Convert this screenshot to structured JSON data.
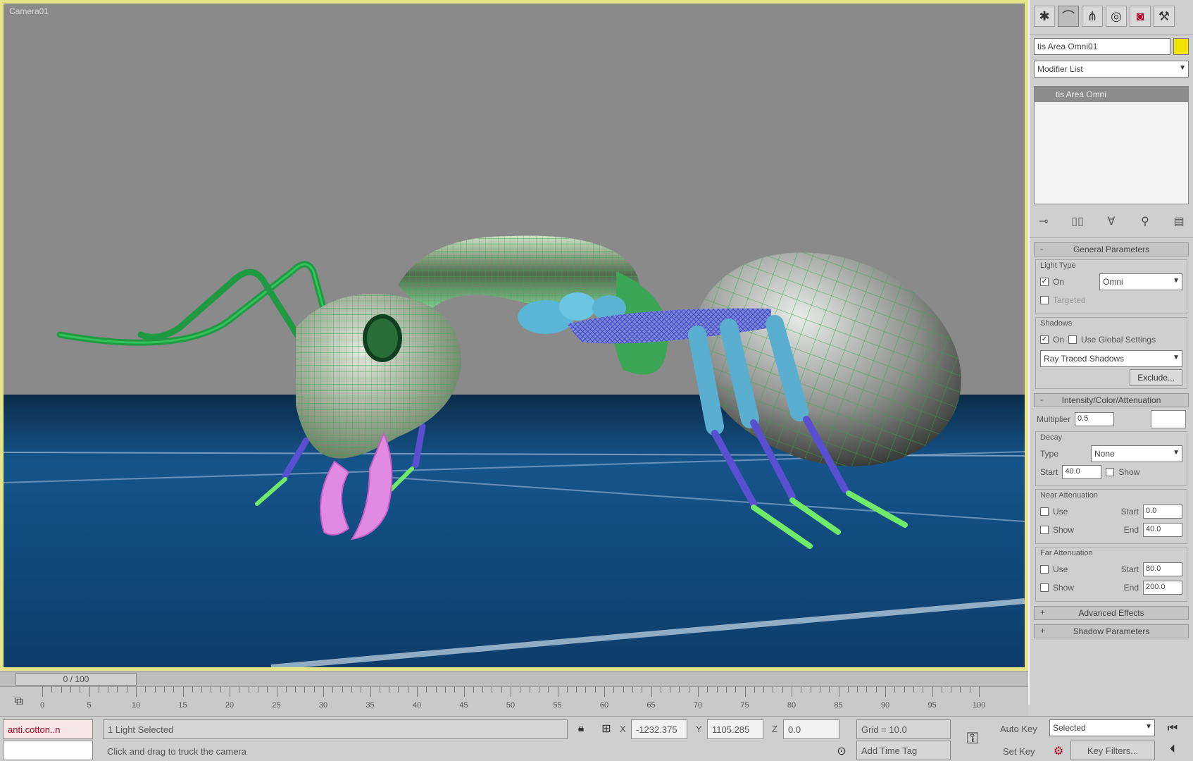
{
  "viewport": {
    "label": "Camera01"
  },
  "command_panel": {
    "tabs": [
      {
        "icon": "create-icon"
      },
      {
        "icon": "modify-icon"
      },
      {
        "icon": "hierarchy-icon"
      },
      {
        "icon": "motion-icon"
      },
      {
        "icon": "display-icon"
      },
      {
        "icon": "utilities-icon"
      }
    ],
    "object_name": "tis Area Omni01",
    "swatch_color": "#f1e400",
    "modifier_list": "Modifier List",
    "stack_item": "tis Area Omni",
    "general_parameters": {
      "title": "General Parameters",
      "light_type": {
        "group": "Light Type",
        "on_label": "On",
        "type_value": "Omni",
        "targeted_label": "Targeted"
      },
      "shadows": {
        "group": "Shadows",
        "on_label": "On",
        "use_global_label": "Use Global Settings",
        "shadow_type": "Ray Traced Shadows",
        "exclude_label": "Exclude..."
      }
    },
    "intensity": {
      "title": "Intensity/Color/Attenuation",
      "multiplier_label": "Multiplier",
      "multiplier_value": "0.5",
      "decay_group": "Decay",
      "type_label": "Type",
      "type_value": "None",
      "start_label": "Start",
      "start_value": "40.0",
      "show_label": "Show",
      "near_group": "Near Attenuation",
      "use_label": "Use",
      "near_start_label": "Start",
      "near_start": "0.0",
      "near_end_label": "End",
      "near_end": "40.0",
      "far_group": "Far Attenuation",
      "far_start_label": "Start",
      "far_start": "80.0",
      "far_end_label": "End",
      "far_end": "200.0"
    },
    "advanced_effects": "Advanced Effects",
    "shadow_parameters": "Shadow Parameters"
  },
  "timeline": {
    "slider_label": "0 / 100",
    "ticks": [
      "0",
      "5",
      "10",
      "15",
      "20",
      "25",
      "30",
      "35",
      "40",
      "45",
      "50",
      "55",
      "60",
      "65",
      "70",
      "75",
      "80",
      "85",
      "90",
      "95",
      "100"
    ]
  },
  "status": {
    "script_field": "anti.cotton..n",
    "selection": "1 Light Selected",
    "prompt": "Click and drag to truck the camera",
    "x_label": "X",
    "x_value": "-1232.375",
    "y_label": "Y",
    "y_value": "1105.285",
    "z_label": "Z",
    "z_value": "0.0",
    "grid": "Grid = 10.0",
    "add_time_tag": "Add Time Tag",
    "auto_key": "Auto Key",
    "set_key": "Set Key",
    "key_mode": "Selected",
    "key_filters": "Key Filters..."
  }
}
